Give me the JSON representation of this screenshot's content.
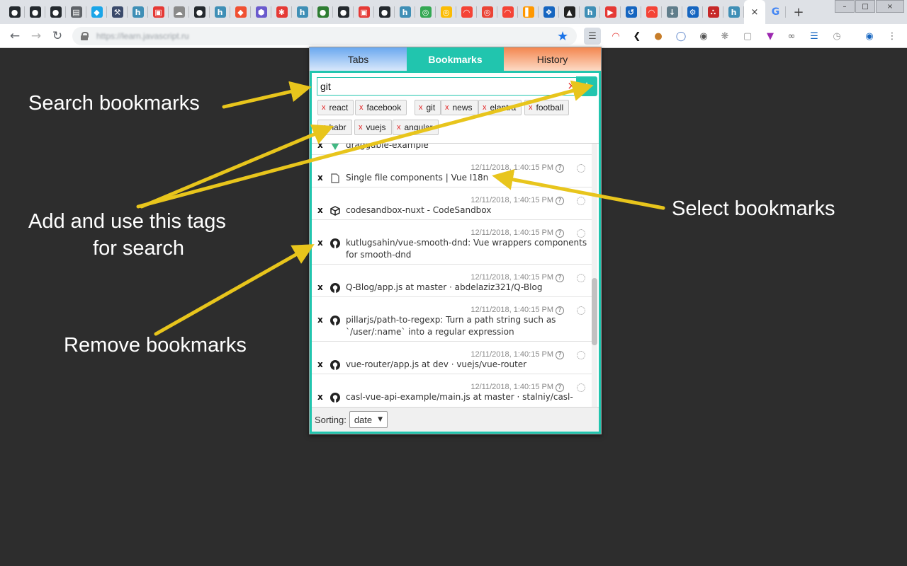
{
  "browser": {
    "favicons": [
      {
        "icon": "github-icon",
        "bg": "#24292e",
        "glyph": "●"
      },
      {
        "icon": "github-icon",
        "bg": "#24292e",
        "glyph": "●"
      },
      {
        "icon": "github-icon",
        "bg": "#24292e",
        "glyph": "●"
      },
      {
        "icon": "book-icon",
        "bg": "#5f6368",
        "glyph": "▤"
      },
      {
        "icon": "cube-icon",
        "bg": "#1aa5e8",
        "glyph": "◆"
      },
      {
        "icon": "tool-icon",
        "bg": "#3b4a6b",
        "glyph": "⚒"
      },
      {
        "icon": "h-icon",
        "bg": "#3f8fb6",
        "glyph": "h"
      },
      {
        "icon": "frame-icon",
        "bg": "#e53935",
        "glyph": "▣"
      },
      {
        "icon": "cloud-icon",
        "bg": "#8a8a8a",
        "glyph": "☁"
      },
      {
        "icon": "github-icon",
        "bg": "#24292e",
        "glyph": "●"
      },
      {
        "icon": "h-icon",
        "bg": "#3f8fb6",
        "glyph": "h"
      },
      {
        "icon": "git-icon",
        "bg": "#f05032",
        "glyph": "◆"
      },
      {
        "icon": "hex-icon",
        "bg": "#6a5acd",
        "glyph": "⬢"
      },
      {
        "icon": "star-person-icon",
        "bg": "#e53935",
        "glyph": "✱"
      },
      {
        "icon": "h-icon",
        "bg": "#3f8fb6",
        "glyph": "h"
      },
      {
        "icon": "circle-icon",
        "bg": "#2e7d32",
        "glyph": "●"
      },
      {
        "icon": "github-icon",
        "bg": "#24292e",
        "glyph": "●"
      },
      {
        "icon": "frame-icon",
        "bg": "#e53935",
        "glyph": "▣"
      },
      {
        "icon": "github-icon",
        "bg": "#24292e",
        "glyph": "●"
      },
      {
        "icon": "h-icon",
        "bg": "#3f8fb6",
        "glyph": "h"
      },
      {
        "icon": "chrome-icon",
        "bg": "#34a853",
        "glyph": "◎"
      },
      {
        "icon": "chrome-icon",
        "bg": "#fbbc05",
        "glyph": "◎"
      },
      {
        "icon": "rainbow-icon",
        "bg": "#f44336",
        "glyph": "◠"
      },
      {
        "icon": "chrome-icon",
        "bg": "#ea4335",
        "glyph": "◎"
      },
      {
        "icon": "rainbow-icon",
        "bg": "#f44336",
        "glyph": "◠"
      },
      {
        "icon": "bar-chart-icon",
        "bg": "#ff9800",
        "glyph": "▌"
      },
      {
        "icon": "puzzle-icon",
        "bg": "#1565c0",
        "glyph": "❖"
      },
      {
        "icon": "graduation-icon",
        "bg": "#212121",
        "glyph": "▲"
      },
      {
        "icon": "h-icon",
        "bg": "#3f8fb6",
        "glyph": "h"
      },
      {
        "icon": "youtube-icon",
        "bg": "#e53935",
        "glyph": "▶"
      },
      {
        "icon": "history-icon",
        "bg": "#1565c0",
        "glyph": "↺"
      },
      {
        "icon": "rainbow-icon",
        "bg": "#f44336",
        "glyph": "◠"
      },
      {
        "icon": "download-icon",
        "bg": "#607d8b",
        "glyph": "↓"
      },
      {
        "icon": "gear-icon",
        "bg": "#1565c0",
        "glyph": "⚙"
      },
      {
        "icon": "graph-icon",
        "bg": "#c62828",
        "glyph": "∴"
      },
      {
        "icon": "h-icon",
        "bg": "#3f8fb6",
        "glyph": "h"
      }
    ],
    "active_tab_close": "×",
    "active_favicon": {
      "icon": "google-icon",
      "bg": "#fff",
      "glyph": "G"
    },
    "new_tab": "+",
    "window_controls": [
      "–",
      "□",
      "×"
    ],
    "url": "https://learn.javascript.ru"
  },
  "popup": {
    "tabs": [
      "Tabs",
      "Bookmarks",
      "History"
    ],
    "search_value": "git",
    "search_clear": "×",
    "add_button": "+",
    "tags": [
      {
        "label": "react"
      },
      {
        "label": "facebook"
      },
      {
        "label": "git"
      },
      {
        "label": "news"
      },
      {
        "label": "elantra"
      },
      {
        "label": "football"
      },
      {
        "label": "habr"
      },
      {
        "label": "vuejs"
      },
      {
        "label": "angular"
      }
    ],
    "tag_remove": "x",
    "bookmarks": [
      {
        "title": "draggable-example",
        "date": "",
        "icon": "vue-icon"
      },
      {
        "title": "Single file components | Vue I18n",
        "date": "12/11/2018, 1:40:15 PM",
        "icon": "file-icon"
      },
      {
        "title": "codesandbox-nuxt - CodeSandbox",
        "date": "12/11/2018, 1:40:15 PM",
        "icon": "codesandbox-icon"
      },
      {
        "title": "kutlugsahin/vue-smooth-dnd: Vue wrappers components for smooth-dnd",
        "date": "12/11/2018, 1:40:15 PM",
        "icon": "github-icon"
      },
      {
        "title": "Q-Blog/app.js at master · abdelaziz321/Q-Blog",
        "date": "12/11/2018, 1:40:15 PM",
        "icon": "github-icon"
      },
      {
        "title": "pillarjs/path-to-regexp: Turn a path string such as `/user/:name` into a regular expression",
        "date": "12/11/2018, 1:40:15 PM",
        "icon": "github-icon"
      },
      {
        "title": "vue-router/app.js at dev · vuejs/vue-router",
        "date": "12/11/2018, 1:40:15 PM",
        "icon": "github-icon"
      },
      {
        "title": "casl-vue-api-example/main.js at master · stalniy/casl-vue-",
        "date": "12/11/2018, 1:40:15 PM",
        "icon": "github-icon"
      }
    ],
    "remove_label": "x",
    "help_label": "?",
    "sorting_label": "Sorting:",
    "sorting_value": "date",
    "sorting_caret": "▼"
  },
  "annotations": {
    "search": "Search bookmarks",
    "tags_line1": "Add and use this tags",
    "tags_line2": "for search",
    "select": "Select bookmarks",
    "remove": "Remove bookmarks"
  },
  "colors": {
    "accent": "#21c5ae",
    "arrow": "#e8c51c",
    "background": "#2d2d2d"
  }
}
